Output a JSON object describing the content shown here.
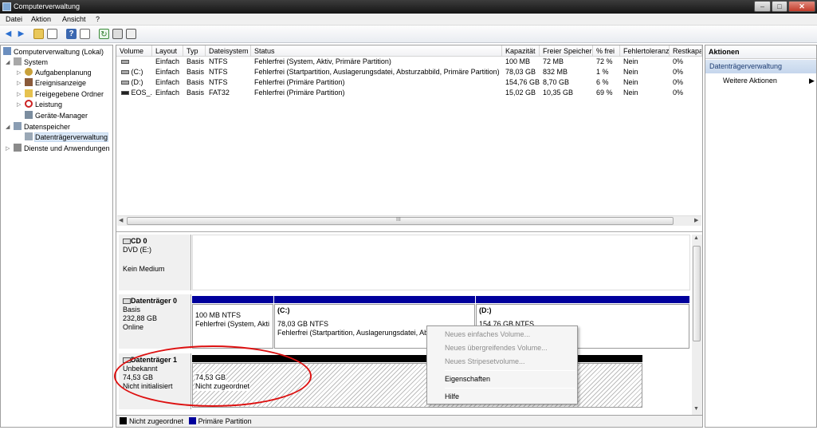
{
  "window": {
    "title": "Computerverwaltung"
  },
  "menu": [
    "Datei",
    "Aktion",
    "Ansicht",
    "?"
  ],
  "tree": {
    "root": "Computerverwaltung (Lokal)",
    "system": "System",
    "aufgaben": "Aufgabenplanung",
    "ereignis": "Ereignisanzeige",
    "freigabe": "Freigegebene Ordner",
    "leistung": "Leistung",
    "geraete": "Geräte-Manager",
    "datenspeicher": "Datenspeicher",
    "dtv": "Datenträgerverwaltung",
    "dienste": "Dienste und Anwendungen"
  },
  "table": {
    "headers": [
      "Volume",
      "Layout",
      "Typ",
      "Dateisystem",
      "Status",
      "Kapazität",
      "Freier Speicher",
      "% frei",
      "Fehlertoleranz",
      "Restkapa"
    ],
    "rows": [
      [
        "",
        "Einfach",
        "Basis",
        "NTFS",
        "Fehlerfrei (System, Aktiv, Primäre Partition)",
        "100 MB",
        "72 MB",
        "72 %",
        "Nein",
        "0%"
      ],
      [
        "(C:)",
        "Einfach",
        "Basis",
        "NTFS",
        "Fehlerfrei (Startpartition, Auslagerungsdatei, Absturzabbild, Primäre Partition)",
        "78,03 GB",
        "832 MB",
        "1 %",
        "Nein",
        "0%"
      ],
      [
        "(D:)",
        "Einfach",
        "Basis",
        "NTFS",
        "Fehlerfrei (Primäre Partition)",
        "154,76 GB",
        "8,70 GB",
        "6 %",
        "Nein",
        "0%"
      ],
      [
        "EOS_...",
        "Einfach",
        "Basis",
        "FAT32",
        "Fehlerfrei (Primäre Partition)",
        "15,02 GB",
        "10,35 GB",
        "69 %",
        "Nein",
        "0%"
      ]
    ],
    "scroll_marker": "III"
  },
  "disks": {
    "cd0": {
      "name": "CD 0",
      "type": "DVD (E:)",
      "media": "Kein Medium"
    },
    "d0": {
      "name": "Datenträger 0",
      "kind": "Basis",
      "size": "232,88 GB",
      "state": "Online",
      "parts": [
        {
          "label": "",
          "size": "100 MB NTFS",
          "status": "Fehlerfrei (System, Akti"
        },
        {
          "label": "(C:)",
          "size": "78,03 GB NTFS",
          "status": "Fehlerfrei (Startpartition, Auslagerungsdatei, Ab"
        },
        {
          "label": "(D:)",
          "size": "154,76 GB NTFS",
          "status": ""
        }
      ]
    },
    "d1": {
      "name": "Datenträger 1",
      "kind": "Unbekannt",
      "size": "74,53 GB",
      "state": "Nicht initialisiert",
      "part": {
        "size": "74,53 GB",
        "status": "Nicht zugeordnet"
      }
    }
  },
  "legend": {
    "unallocated": "Nicht zugeordnet",
    "primary": "Primäre Partition",
    "colors": {
      "unallocated": "#000000",
      "primary": "#00009c"
    }
  },
  "actions": {
    "title": "Aktionen",
    "section": "Datenträgerverwaltung",
    "more": "Weitere Aktionen"
  },
  "context_menu": {
    "items": [
      "Neues einfaches Volume...",
      "Neues übergreifendes Volume...",
      "Neues Stripesetvolume...",
      "Eigenschaften",
      "Hilfe"
    ]
  }
}
